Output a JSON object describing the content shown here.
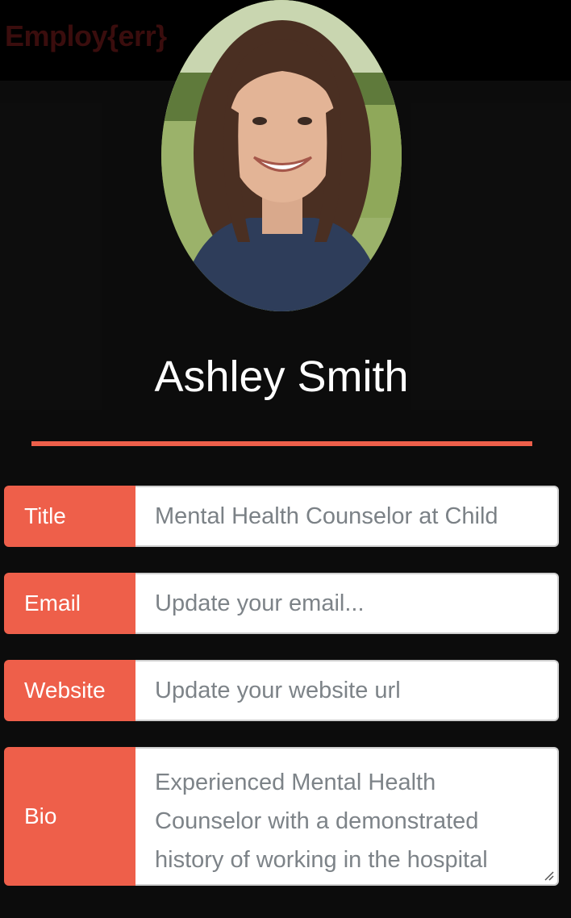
{
  "app": {
    "brand": "Employ{err}"
  },
  "profile": {
    "name": "Ashley Smith",
    "avatar_icon": "profile-photo"
  },
  "form": {
    "title": {
      "label": "Title",
      "value": "Mental Health Counselor at Child"
    },
    "email": {
      "label": "Email",
      "placeholder": "Update your email..."
    },
    "website": {
      "label": "Website",
      "placeholder": "Update your website url"
    },
    "bio": {
      "label": "Bio",
      "value": "Experienced Mental Health Counselor with a demonstrated history of working in the hospital"
    }
  },
  "colors": {
    "accent": "#ee5f4a",
    "background": "#131313",
    "navbar": "#000000"
  }
}
